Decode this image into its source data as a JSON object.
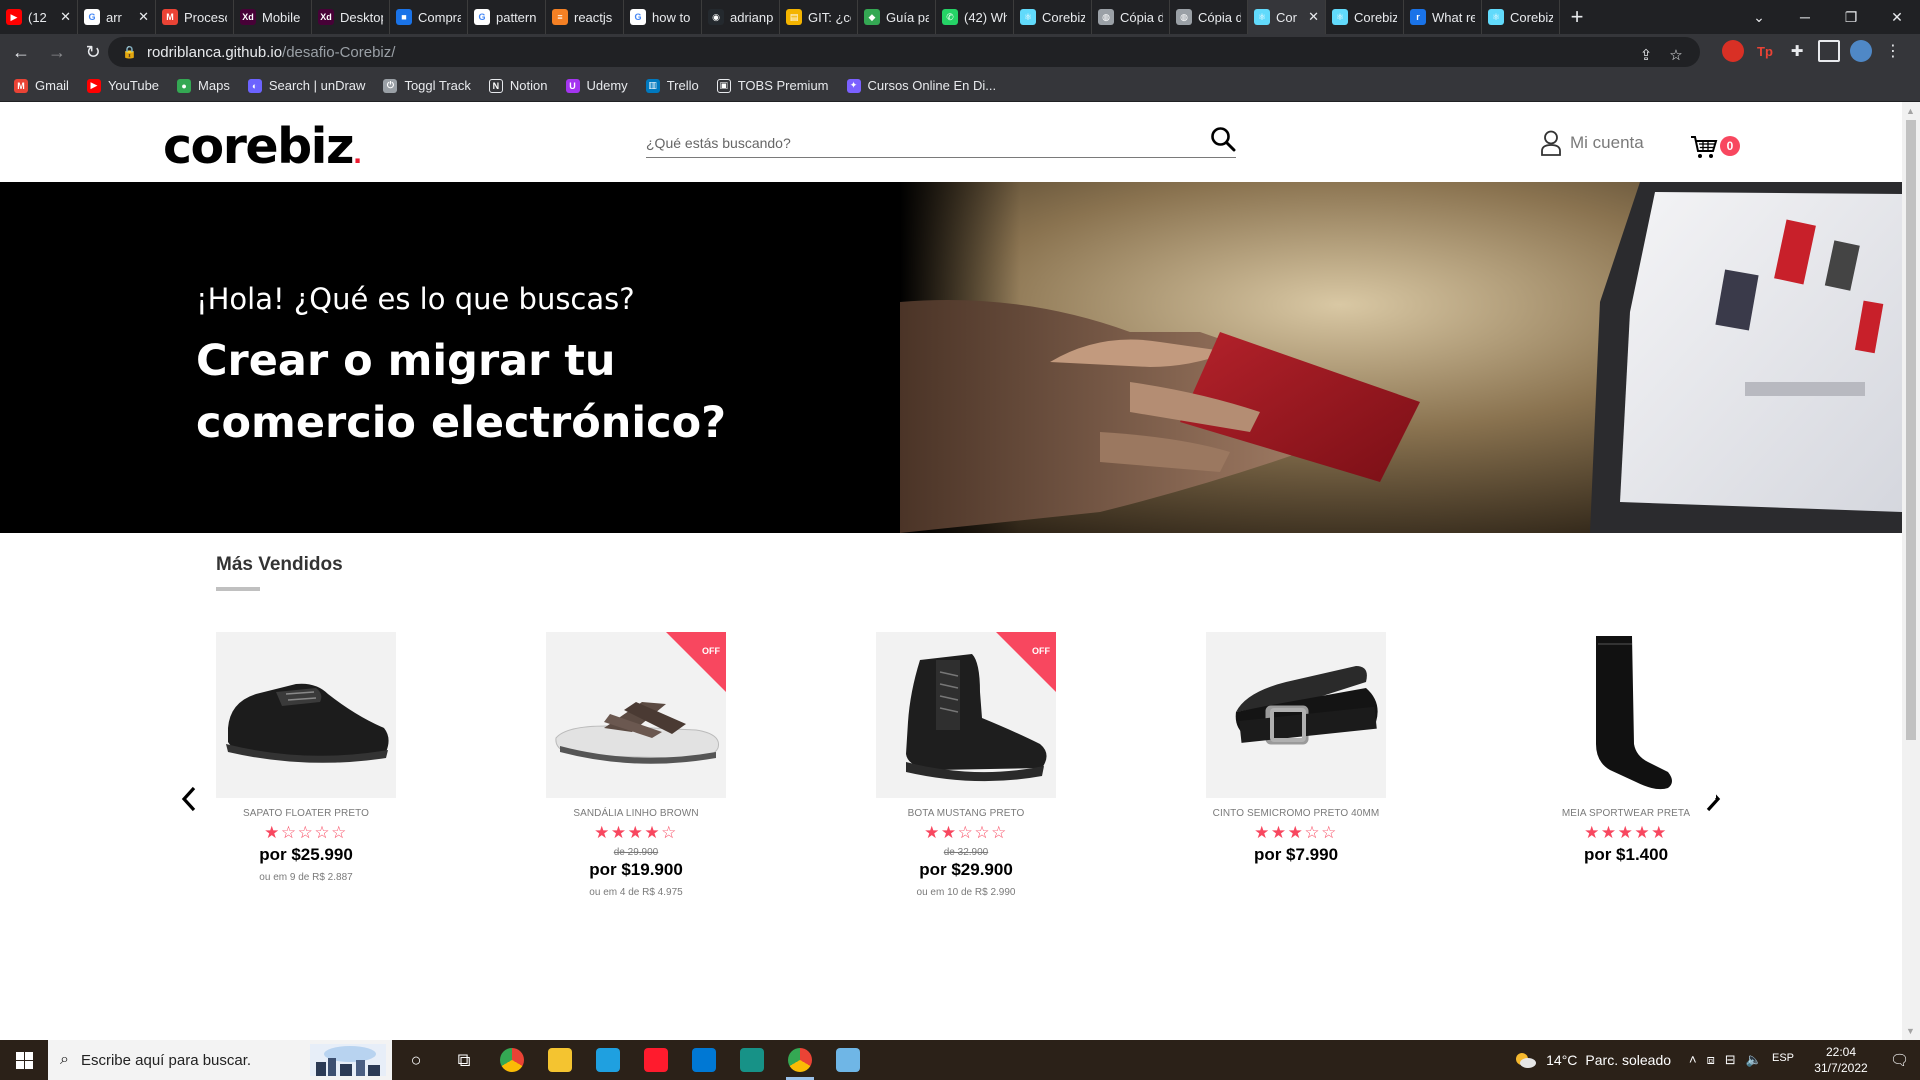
{
  "browser": {
    "tabs": [
      {
        "title": "(12",
        "icon": "youtube-icon",
        "color": "#ff0000",
        "glyph": "▶",
        "closable": true
      },
      {
        "title": "arr",
        "icon": "google-icon",
        "color": "#ffffff",
        "glyph": "G",
        "closable": true
      },
      {
        "title": "Proceso",
        "icon": "gmail-icon",
        "color": "#ea4335",
        "glyph": "M",
        "closable": false
      },
      {
        "title": "Mobile",
        "icon": "adobe-xd-icon",
        "color": "#470137",
        "glyph": "Xd",
        "closable": false
      },
      {
        "title": "Desktop",
        "icon": "adobe-xd-icon",
        "color": "#470137",
        "glyph": "Xd",
        "closable": false
      },
      {
        "title": "Compra",
        "icon": "site-icon",
        "color": "#1a73e8",
        "glyph": "■",
        "closable": false
      },
      {
        "title": "pattern",
        "icon": "google-icon",
        "color": "#ffffff",
        "glyph": "G",
        "closable": false
      },
      {
        "title": "reactjs",
        "icon": "stackoverflow-icon",
        "color": "#f48024",
        "glyph": "≡",
        "closable": false
      },
      {
        "title": "how to",
        "icon": "google-icon",
        "color": "#ffffff",
        "glyph": "G",
        "closable": false
      },
      {
        "title": "adrianp",
        "icon": "github-icon",
        "color": "#24292e",
        "glyph": "◉",
        "closable": false
      },
      {
        "title": "GIT: ¿có",
        "icon": "docs-icon",
        "color": "#f4b400",
        "glyph": "▤",
        "closable": false
      },
      {
        "title": "Guía pa",
        "icon": "diamond-icon",
        "color": "#34a853",
        "glyph": "◆",
        "closable": false
      },
      {
        "title": "(42) Wh",
        "icon": "whatsapp-icon",
        "color": "#25d366",
        "glyph": "✆",
        "closable": false
      },
      {
        "title": "Corebiz",
        "icon": "react-icon",
        "color": "#61dafb",
        "glyph": "⚛",
        "closable": false
      },
      {
        "title": "Cópia d",
        "icon": "globe-icon",
        "color": "#9aa0a6",
        "glyph": "◍",
        "closable": false
      },
      {
        "title": "Cópia d",
        "icon": "globe-icon",
        "color": "#9aa0a6",
        "glyph": "◍",
        "closable": false
      },
      {
        "title": "Cor",
        "icon": "react-icon",
        "color": "#61dafb",
        "glyph": "⚛",
        "closable": true,
        "active": true
      },
      {
        "title": "Corebiz",
        "icon": "react-icon",
        "color": "#61dafb",
        "glyph": "⚛",
        "closable": false
      },
      {
        "title": "What re",
        "icon": "r-icon",
        "color": "#1a73e8",
        "glyph": "r",
        "closable": false
      },
      {
        "title": "Corebiz",
        "icon": "react-icon",
        "color": "#61dafb",
        "glyph": "⚛",
        "closable": false
      }
    ],
    "url_host": "rodriblanca.github.io",
    "url_path": "/desafio-Corebiz/",
    "bookmarks": [
      {
        "label": "Gmail",
        "icon": "gmail-icon",
        "color": "#ea4335",
        "glyph": "M"
      },
      {
        "label": "YouTube",
        "icon": "youtube-icon",
        "color": "#ff0000",
        "glyph": "▶"
      },
      {
        "label": "Maps",
        "icon": "maps-icon",
        "color": "#34a853",
        "glyph": "●"
      },
      {
        "label": "Search | unDraw",
        "icon": "undraw-icon",
        "color": "#6c63ff",
        "glyph": "◐"
      },
      {
        "label": "Toggl Track",
        "icon": "toggl-icon",
        "color": "#9aa0a6",
        "glyph": "⏻"
      },
      {
        "label": "Notion",
        "icon": "notion-icon",
        "color": "#ffffff",
        "glyph": "N"
      },
      {
        "label": "Udemy",
        "icon": "udemy-icon",
        "color": "#a435f0",
        "glyph": "U"
      },
      {
        "label": "Trello",
        "icon": "trello-icon",
        "color": "#0079bf",
        "glyph": "▥"
      },
      {
        "label": "TOBS Premium",
        "icon": "tobs-icon",
        "color": "#ffffff",
        "glyph": "▣"
      },
      {
        "label": "Cursos Online En Di...",
        "icon": "courses-icon",
        "color": "#7b61ff",
        "glyph": "✦"
      }
    ]
  },
  "site": {
    "logo_text": "corebiz",
    "logo_dot": ".",
    "search_placeholder": "¿Qué estás buscando?",
    "account_label": "Mi cuenta",
    "cart_count": "0",
    "hero": {
      "greeting": "¡Hola! ¿Qué es lo que buscas?",
      "title_line1": "Crear o migrar tu",
      "title_line2": "comercio electrónico?"
    },
    "section_title": "Más Vendidos",
    "products": [
      {
        "name": "SAPATO FLOATER PRETO",
        "rating": 1,
        "stars": "★☆☆☆☆",
        "off": false,
        "old_price": "",
        "price": "por $25.990",
        "installments": "ou em 9 de R$ 2.887",
        "image": "shoe"
      },
      {
        "name": "SANDÁLIA LINHO BROWN",
        "rating": 4,
        "stars": "★★★★☆",
        "off": true,
        "off_label": "OFF",
        "old_price": "de 29.900",
        "price": "por $19.900",
        "installments": "ou em 4 de R$ 4.975",
        "image": "sandal"
      },
      {
        "name": "BOTA MUSTANG PRETO",
        "rating": 2,
        "stars": "★★☆☆☆",
        "off": true,
        "off_label": "OFF",
        "old_price": "de 32.900",
        "price": "por $29.900",
        "installments": "ou em 10 de R$ 2.990",
        "image": "boot"
      },
      {
        "name": "CINTO SEMICROMO PRETO 40MM",
        "rating": 3,
        "stars": "★★★☆☆",
        "off": false,
        "old_price": "",
        "price": "por $7.990",
        "installments": "",
        "image": "belt"
      },
      {
        "name": "MEIA SPORTWEAR PRETA",
        "rating": 5,
        "stars": "★★★★★",
        "off": false,
        "old_price": "",
        "price": "por $1.400",
        "installments": "",
        "image": "sock"
      }
    ],
    "colors": {
      "accent": "#f8475f",
      "off_flag": "#f8475f",
      "hero_bg": "#000000"
    }
  },
  "taskbar": {
    "search_placeholder": "Escribe aquí para buscar.",
    "weather_temp": "14°C",
    "weather_text": "Parc. soleado",
    "language": "ESP",
    "time": "22:04",
    "date": "31/7/2022",
    "apps": [
      {
        "name": "cortana-icon",
        "glyph": "○",
        "color": "transparent"
      },
      {
        "name": "task-view-icon",
        "glyph": "⧉",
        "color": "transparent"
      },
      {
        "name": "chrome-taskbar-icon",
        "glyph": "",
        "color": "#ea4335"
      },
      {
        "name": "file-explorer-icon",
        "glyph": "",
        "color": "#f4c430"
      },
      {
        "name": "edge-icon",
        "glyph": "",
        "color": "#1fa0e0"
      },
      {
        "name": "opera-icon",
        "glyph": "",
        "color": "#ff1b2d"
      },
      {
        "name": "vscode-icon",
        "glyph": "",
        "color": "#0078d4"
      },
      {
        "name": "gitkraken-icon",
        "glyph": "",
        "color": "#179287"
      },
      {
        "name": "chrome-active-icon",
        "glyph": "",
        "color": "#ea4335",
        "active": true
      },
      {
        "name": "notes-icon",
        "glyph": "",
        "color": "#6fb6e6"
      }
    ]
  }
}
